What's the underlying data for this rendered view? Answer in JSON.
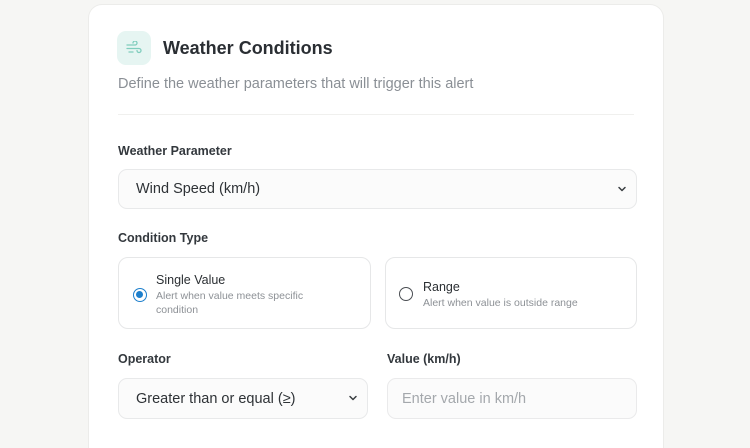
{
  "card": {
    "title": "Weather Conditions",
    "subtitle": "Define the weather parameters that will trigger this alert",
    "icon": "wind-icon"
  },
  "weather_parameter": {
    "label": "Weather Parameter",
    "selected": "Wind Speed (km/h)"
  },
  "condition_type": {
    "label": "Condition Type",
    "options": [
      {
        "title": "Single Value",
        "description": "Alert when value meets specific condition",
        "selected": true
      },
      {
        "title": "Range",
        "description": "Alert when value is outside range",
        "selected": false
      }
    ]
  },
  "operator": {
    "label": "Operator",
    "selected": "Greater than or equal (≥)"
  },
  "value": {
    "label": "Value (km/h)",
    "placeholder": "Enter value in km/h",
    "current": ""
  },
  "colors": {
    "accent": "#1d7fcc",
    "icon_bg": "#e6f5f2",
    "icon_fg": "#7fcdbd"
  }
}
